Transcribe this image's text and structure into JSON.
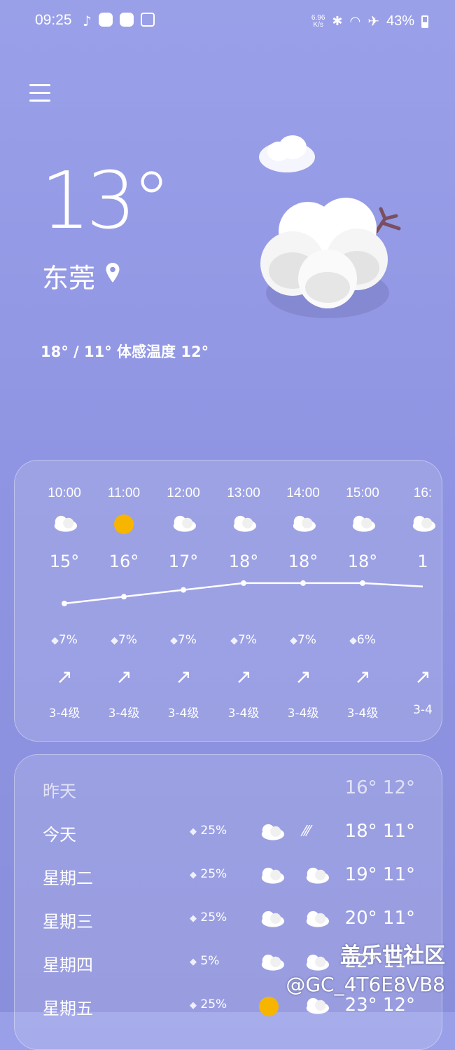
{
  "status": {
    "time": "09:25",
    "net_speed_top": "6.96",
    "net_speed_bottom": "K/s",
    "battery": "43%"
  },
  "current": {
    "temp": "13°",
    "city": "东莞",
    "hilo": "18° / 11° 体感温度 12°"
  },
  "hourly": [
    {
      "time": "10:00",
      "icon": "cloud-sun-icon",
      "temp": "15°",
      "rain": "7%",
      "wind": "3-4级"
    },
    {
      "time": "11:00",
      "icon": "sun-icon",
      "temp": "16°",
      "rain": "7%",
      "wind": "3-4级"
    },
    {
      "time": "12:00",
      "icon": "cloud-sun-icon",
      "temp": "17°",
      "rain": "7%",
      "wind": "3-4级"
    },
    {
      "time": "13:00",
      "icon": "cloud-sun-icon",
      "temp": "18°",
      "rain": "7%",
      "wind": "3-4级"
    },
    {
      "time": "14:00",
      "icon": "cloud-sun-icon",
      "temp": "18°",
      "rain": "7%",
      "wind": "3-4级"
    },
    {
      "time": "15:00",
      "icon": "cloud-sun-icon",
      "temp": "18°",
      "rain": "6%",
      "wind": "3-4级"
    },
    {
      "time": "16:",
      "icon": "cloud-icon",
      "temp": "1",
      "rain": "",
      "wind": "3-4"
    }
  ],
  "daily": [
    {
      "day": "昨天",
      "rain": "",
      "temps": "16° 12°"
    },
    {
      "day": "今天",
      "rain": "25%",
      "temps": "18° 11°"
    },
    {
      "day": "星期二",
      "rain": "25%",
      "temps": "19° 11°"
    },
    {
      "day": "星期三",
      "rain": "25%",
      "temps": "20° 11°"
    },
    {
      "day": "星期四",
      "rain": "5%",
      "temps": "22° 11°"
    },
    {
      "day": "星期五",
      "rain": "25%",
      "temps": "23° 12°"
    }
  ],
  "watermark": {
    "line1": "盖乐世社区",
    "line2": "@GC_4T6E8VB8"
  }
}
